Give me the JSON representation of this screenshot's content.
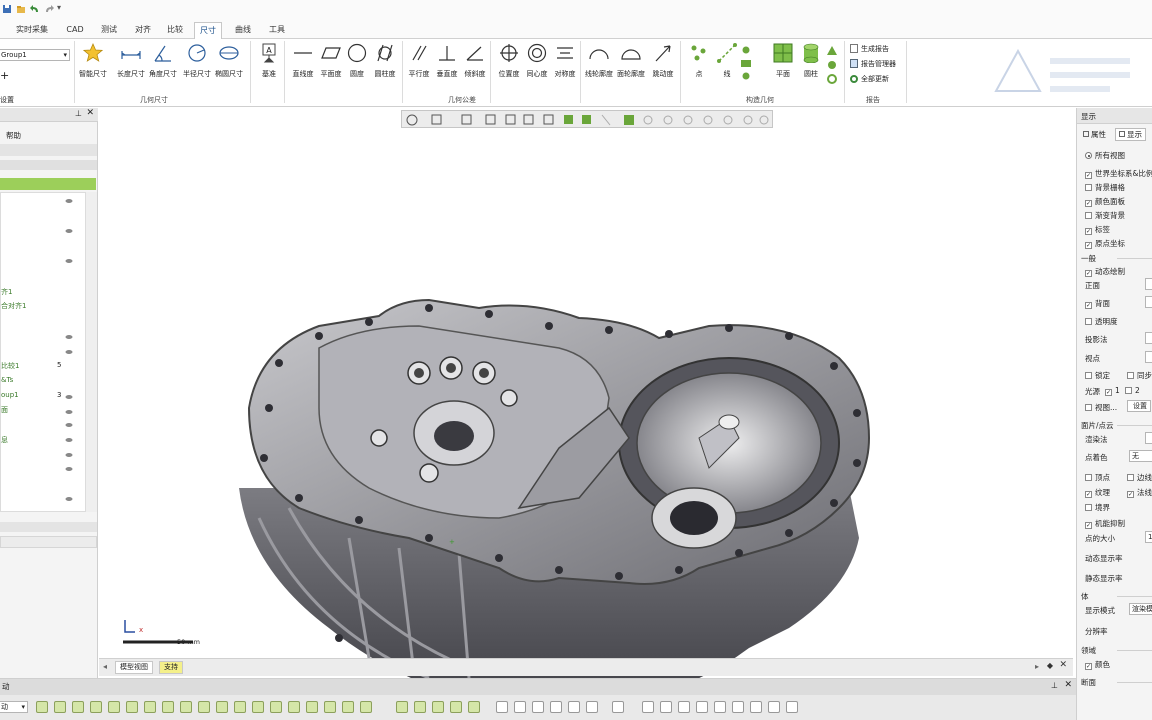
{
  "menubar": {
    "tabs": [
      {
        "label": "实时采集"
      },
      {
        "label": "CAD"
      },
      {
        "label": "测试"
      },
      {
        "label": "对齐"
      },
      {
        "label": "比较"
      },
      {
        "label": "尺寸",
        "active": true
      },
      {
        "label": "曲线"
      },
      {
        "label": "工具"
      }
    ]
  },
  "ribbon": {
    "group_dropdown": "Group1",
    "add_symbol": "+",
    "setup_label": "设置",
    "groups": {
      "geometric_dims": "几何尺寸",
      "gdt": "几何公差",
      "construct": "构造几何",
      "report": "报告"
    },
    "dim_tools": [
      "智能尺寸",
      "长度尺寸",
      "角度尺寸",
      "半径尺寸",
      "椭圆尺寸"
    ],
    "datum_tool": "基准",
    "gdt_tools": [
      "直线度",
      "平面度",
      "圆度",
      "圆柱度",
      "平行度",
      "垂直度",
      "倾斜度",
      "位置度",
      "同心度",
      "对称度",
      "线轮廓度",
      "面轮廓度",
      "跳动度"
    ],
    "construct_tools": [
      "点",
      "线",
      "平面",
      "圆柱"
    ],
    "report_items": [
      "生成报告",
      "报告管理器",
      "全部更新"
    ]
  },
  "left_panel": {
    "help_label": "帮助",
    "tree_items": [
      {
        "label": "齐1"
      },
      {
        "label": "合对齐1"
      },
      {
        "label": "比较1",
        "count": "5"
      },
      {
        "label": "&Ts"
      },
      {
        "label": "oup1",
        "count": "3"
      },
      {
        "label": "面"
      },
      {
        "label": "息"
      }
    ]
  },
  "viewport": {
    "scale_label": "50 mm",
    "axis_label": "x",
    "tabs": [
      "模型视图",
      "支持"
    ]
  },
  "right_panel": {
    "title": "显示",
    "tabs": [
      "属性",
      "显示"
    ],
    "all_views": "所有视图",
    "checks_top": [
      {
        "label": "世界坐标系&比例",
        "checked": true
      },
      {
        "label": "背景栅格",
        "checked": false
      },
      {
        "label": "颜色面板",
        "checked": true
      },
      {
        "label": "渐变背景",
        "checked": false
      },
      {
        "label": "标签",
        "checked": true
      },
      {
        "label": "原点坐标",
        "checked": true
      }
    ],
    "section_general": "一般",
    "dynamic_draw": "动态绘制",
    "front_label": "正面",
    "back_label": "背面",
    "transparency": "透明度",
    "projection": "投影法",
    "viewpoint": "视点",
    "lock": "锁定",
    "sync": "同步",
    "light": "光源",
    "light1": "1",
    "light2": "2",
    "view_menu": "视图...",
    "settings_btn": "设置",
    "section_surface": "面片/点云",
    "render_method": "渲染法",
    "point_color": "点着色",
    "point_color_value": "无",
    "vertex": "顶点",
    "edge": "边线",
    "texture": "纹理",
    "normal": "法线",
    "boundary": "境界",
    "suppress": "机能抑制",
    "point_size": "点的大小",
    "point_size_value": "1",
    "dyn_rate": "动态显示率",
    "static_rate": "静态显示率",
    "section_body": "体",
    "display_mode": "显示模式",
    "display_mode_value": "渲染模",
    "resolution": "分辨率",
    "section_domain": "领域",
    "color": "颜色",
    "section_cross": "断面"
  },
  "statusbar": {
    "left_label": "动"
  },
  "colors": {
    "accent": "#1a4f8a",
    "tree_highlight": "#9ccf5a",
    "status_icon": "#d5e6a8",
    "part_gray": "#8a8a8e"
  }
}
